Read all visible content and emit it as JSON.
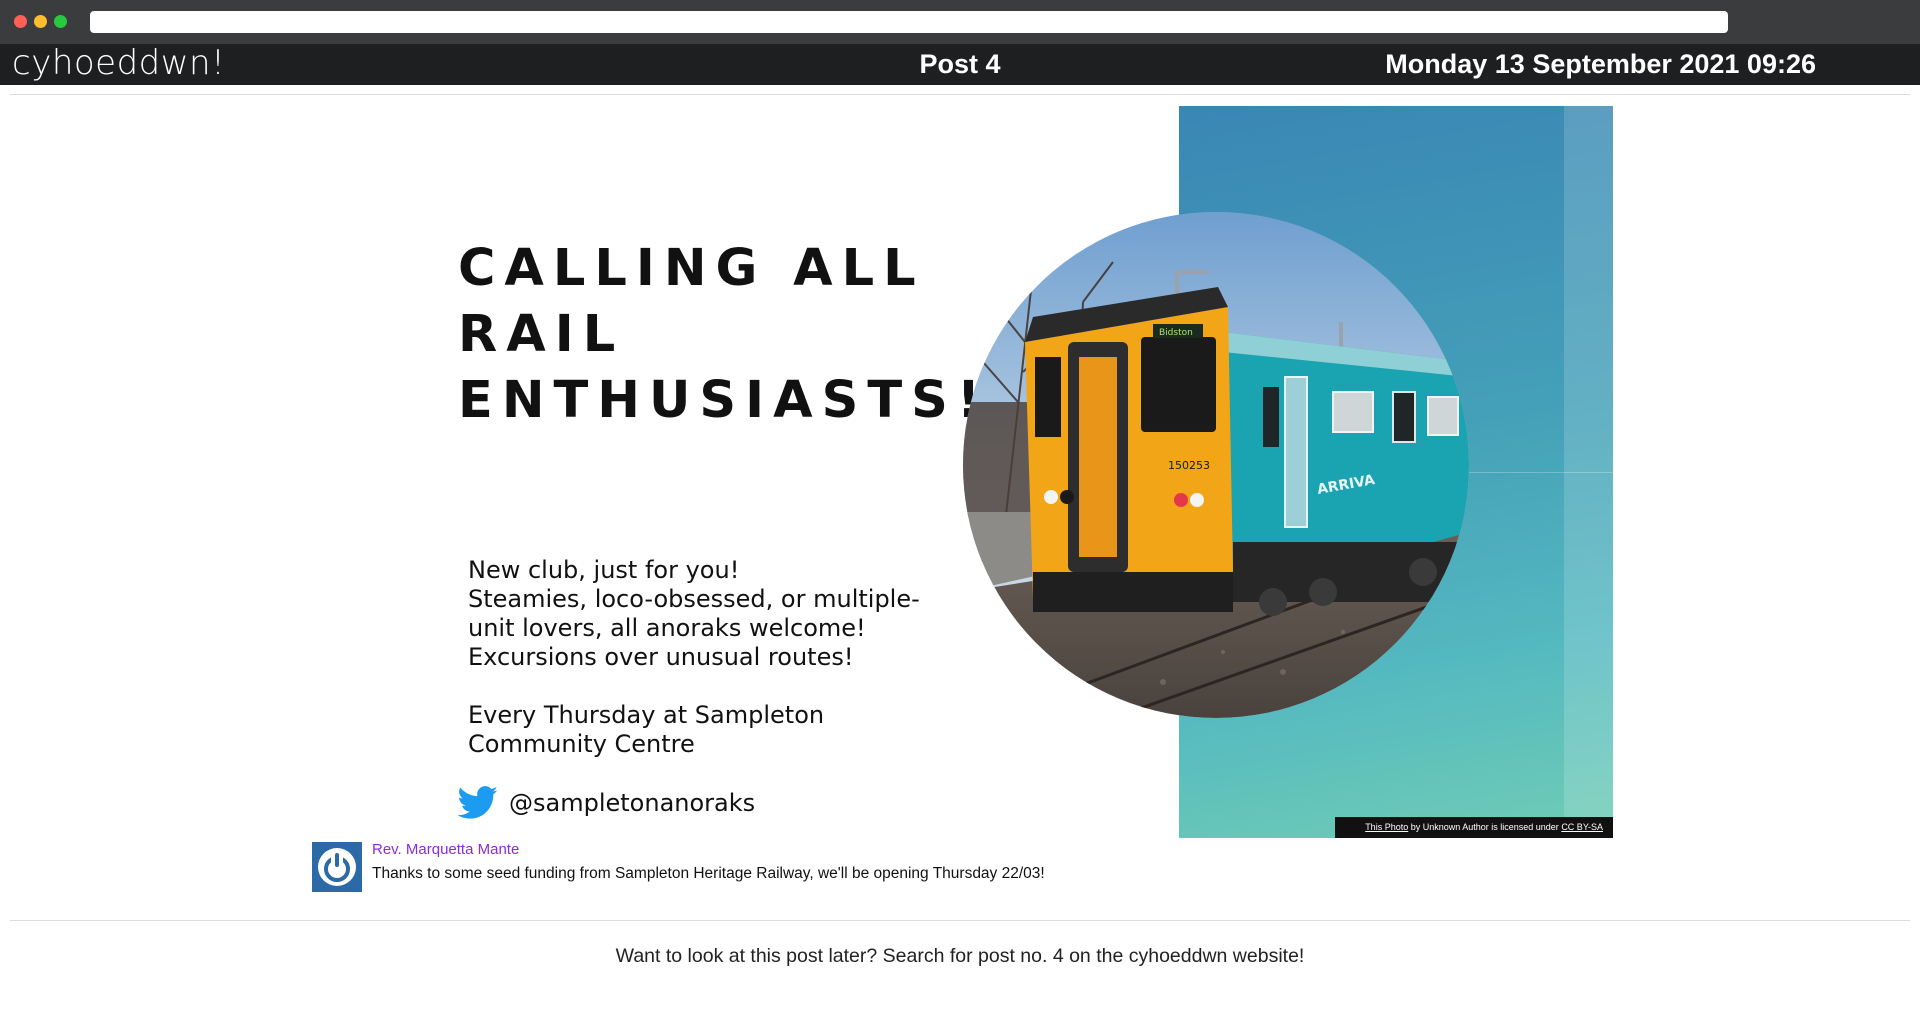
{
  "browser": {
    "url": ""
  },
  "header": {
    "brand": "cyhoeddwn!",
    "post_title": "Post 4",
    "datetime": "Monday 13 September 2021 09:26"
  },
  "poster": {
    "headline_lines": [
      "CALLING ALL",
      "RAIL",
      "ENTHUSIASTS!"
    ],
    "body_lines_1": [
      "New club, just for you!",
      "Steamies, loco-obsessed, or multiple-",
      "unit lovers, all anoraks welcome!",
      "Excursions over unusual routes!"
    ],
    "body_lines_2": [
      "Every Thursday at Sampleton",
      "Community Centre"
    ],
    "twitter_handle": "@sampletonanoraks",
    "photo_credit": {
      "photo_link": "This Photo",
      "middle": " by Unknown Author is licensed under ",
      "license": "CC BY-SA"
    },
    "train_destination": "Bidston",
    "train_number": "150253",
    "train_livery": "ARRIVA",
    "colors": {
      "teal_top": "#3a86b5",
      "teal_bottom": "#6fcdb5",
      "train_yellow": "#f2a516",
      "train_teal": "#1aa3b0"
    }
  },
  "comment": {
    "author": "Rev. Marquetta Mante",
    "text": "Thanks to some seed funding from Sampleton Heritage Railway, we'll be opening Thursday 22/03!",
    "author_color": "#8a2be2",
    "avatar_icon": "power-icon"
  },
  "footer": {
    "text": "Want to look at this post later? Search for post no. 4 on the cyhoeddwn website!"
  }
}
